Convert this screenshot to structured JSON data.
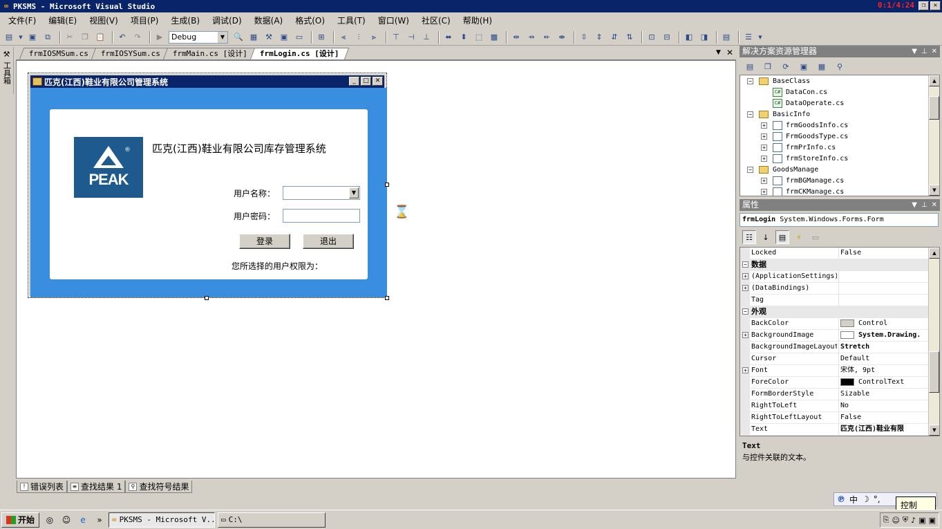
{
  "window": {
    "title": "PKSMS - Microsoft Visual Studio",
    "timer": "0:1/4:24"
  },
  "menu": [
    "文件(F)",
    "编辑(E)",
    "视图(V)",
    "项目(P)",
    "生成(B)",
    "调试(D)",
    "数据(A)",
    "格式(O)",
    "工具(T)",
    "窗口(W)",
    "社区(C)",
    "帮助(H)"
  ],
  "toolbar": {
    "config": "Debug"
  },
  "toolbox": {
    "label": "工具箱"
  },
  "doc_tabs": [
    "frmIOSMSum.cs",
    "frmIOSYSum.cs",
    "frmMain.cs [设计]",
    "frmLogin.cs [设计]"
  ],
  "form": {
    "title": "匹克(江西)鞋业有限公司管理系统",
    "logo_text": "PEAK",
    "logo_reg": "®",
    "system_name": "匹克(江西)鞋业有限公司库存管理系统",
    "username_label": "用户名称：",
    "password_label": "用户密码：",
    "login_button": "登录",
    "exit_button": "退出",
    "permission_label": "您所选择的用户权限为："
  },
  "solution_explorer": {
    "title": "解决方案资源管理器",
    "items": [
      {
        "label": "BaseClass",
        "type": "folder",
        "expand": "−"
      },
      {
        "label": "DataCon.cs",
        "type": "cs",
        "expand": ""
      },
      {
        "label": "DataOperate.cs",
        "type": "cs",
        "expand": ""
      },
      {
        "label": "BasicInfo",
        "type": "folder",
        "expand": "−"
      },
      {
        "label": "frmGoodsInfo.cs",
        "type": "form",
        "expand": "+"
      },
      {
        "label": "FrmGoodsType.cs",
        "type": "form",
        "expand": "+"
      },
      {
        "label": "frmPrInfo.cs",
        "type": "form",
        "expand": "+"
      },
      {
        "label": "frmStoreInfo.cs",
        "type": "form",
        "expand": "+"
      },
      {
        "label": "GoodsManage",
        "type": "folder",
        "expand": "−"
      },
      {
        "label": "frmBGManage.cs",
        "type": "form",
        "expand": "+"
      },
      {
        "label": "frmCKManage.cs",
        "type": "form",
        "expand": "+"
      }
    ]
  },
  "properties": {
    "title": "属性",
    "object_name": "frmLogin",
    "object_type": "System.Windows.Forms.Form",
    "rows": [
      {
        "kind": "prop",
        "name": "Locked",
        "value": "False",
        "expand": "",
        "swatch": "",
        "bold": false
      },
      {
        "kind": "cat",
        "name": "数据",
        "expand": "−"
      },
      {
        "kind": "prop",
        "name": "(ApplicationSettings)",
        "value": "",
        "expand": "+",
        "swatch": "",
        "bold": false
      },
      {
        "kind": "prop",
        "name": "(DataBindings)",
        "value": "",
        "expand": "+",
        "swatch": "",
        "bold": false
      },
      {
        "kind": "prop",
        "name": "Tag",
        "value": "",
        "expand": "",
        "swatch": "",
        "bold": false
      },
      {
        "kind": "cat",
        "name": "外观",
        "expand": "−"
      },
      {
        "kind": "prop",
        "name": "BackColor",
        "value": "Control",
        "expand": "",
        "swatch": "#d4d0c8",
        "bold": false
      },
      {
        "kind": "prop",
        "name": "BackgroundImage",
        "value": "System.Drawing.",
        "expand": "+",
        "swatch": "#ffffff",
        "bold": true
      },
      {
        "kind": "prop",
        "name": "BackgroundImageLayout",
        "value": "Stretch",
        "expand": "",
        "swatch": "",
        "bold": true
      },
      {
        "kind": "prop",
        "name": "Cursor",
        "value": "Default",
        "expand": "",
        "swatch": "",
        "bold": false
      },
      {
        "kind": "prop",
        "name": "Font",
        "value": "宋体, 9pt",
        "expand": "+",
        "swatch": "",
        "bold": false
      },
      {
        "kind": "prop",
        "name": "ForeColor",
        "value": "ControlText",
        "expand": "",
        "swatch": "#000000",
        "bold": false
      },
      {
        "kind": "prop",
        "name": "FormBorderStyle",
        "value": "Sizable",
        "expand": "",
        "swatch": "",
        "bold": false
      },
      {
        "kind": "prop",
        "name": "RightToLeft",
        "value": "No",
        "expand": "",
        "swatch": "",
        "bold": false
      },
      {
        "kind": "prop",
        "name": "RightToLeftLayout",
        "value": "False",
        "expand": "",
        "swatch": "",
        "bold": false
      },
      {
        "kind": "prop",
        "name": "Text",
        "value": "匹克(江西)鞋业有限",
        "expand": "",
        "swatch": "",
        "bold": true
      }
    ],
    "desc_title": "Text",
    "desc_text": "与控件关联的文本。"
  },
  "bottom_tabs": [
    "错误列表",
    "查找结果 1",
    "查找符号结果"
  ],
  "ime": {
    "lang": "中",
    "tooltip": "控制"
  },
  "taskbar": {
    "start": "开始",
    "tasks": [
      "PKSMS - Microsoft V...",
      "C:\\"
    ]
  },
  "colors": {
    "titlebar": "#0a246a",
    "form_body": "#3a8ee0",
    "logo_bg": "#1e5a8e"
  }
}
